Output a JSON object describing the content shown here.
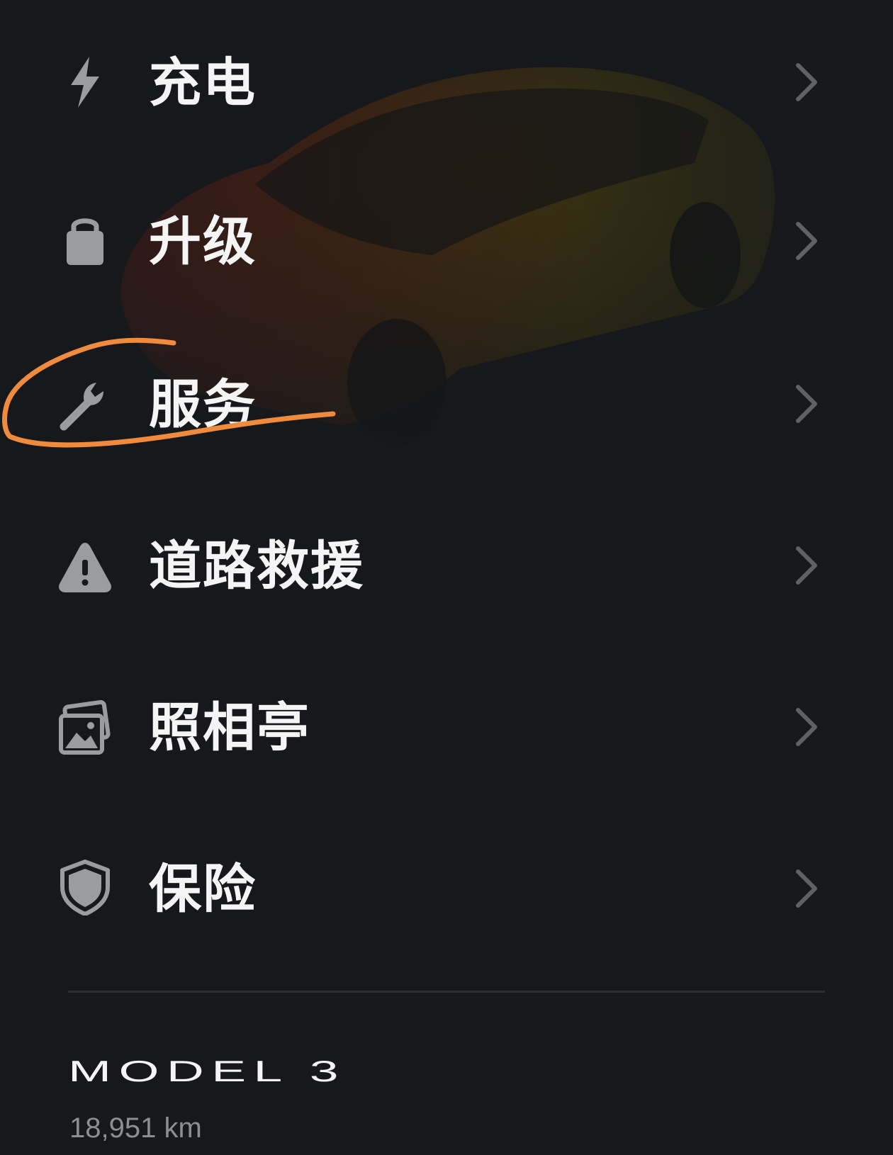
{
  "menu": {
    "items": [
      {
        "id": "charging",
        "label": "充电",
        "icon": "lightning-bolt-icon"
      },
      {
        "id": "upgrades",
        "label": "升级",
        "icon": "shopping-bag-icon"
      },
      {
        "id": "service",
        "label": "服务",
        "icon": "wrench-icon"
      },
      {
        "id": "roadside",
        "label": "道路救援",
        "icon": "warning-triangle-icon"
      },
      {
        "id": "photobooth",
        "label": "照相亭",
        "icon": "photos-icon"
      },
      {
        "id": "insurance",
        "label": "保险",
        "icon": "shield-icon"
      }
    ]
  },
  "vehicle": {
    "model_name": "MODEL 3",
    "odometer": "18,951 km"
  },
  "colors": {
    "background": "#16181b",
    "text": "#f5f5f5",
    "icon": "#9a9c9f",
    "chevron": "#5f6165",
    "annotation": "#f08a3c",
    "car": "#d4a21c"
  }
}
